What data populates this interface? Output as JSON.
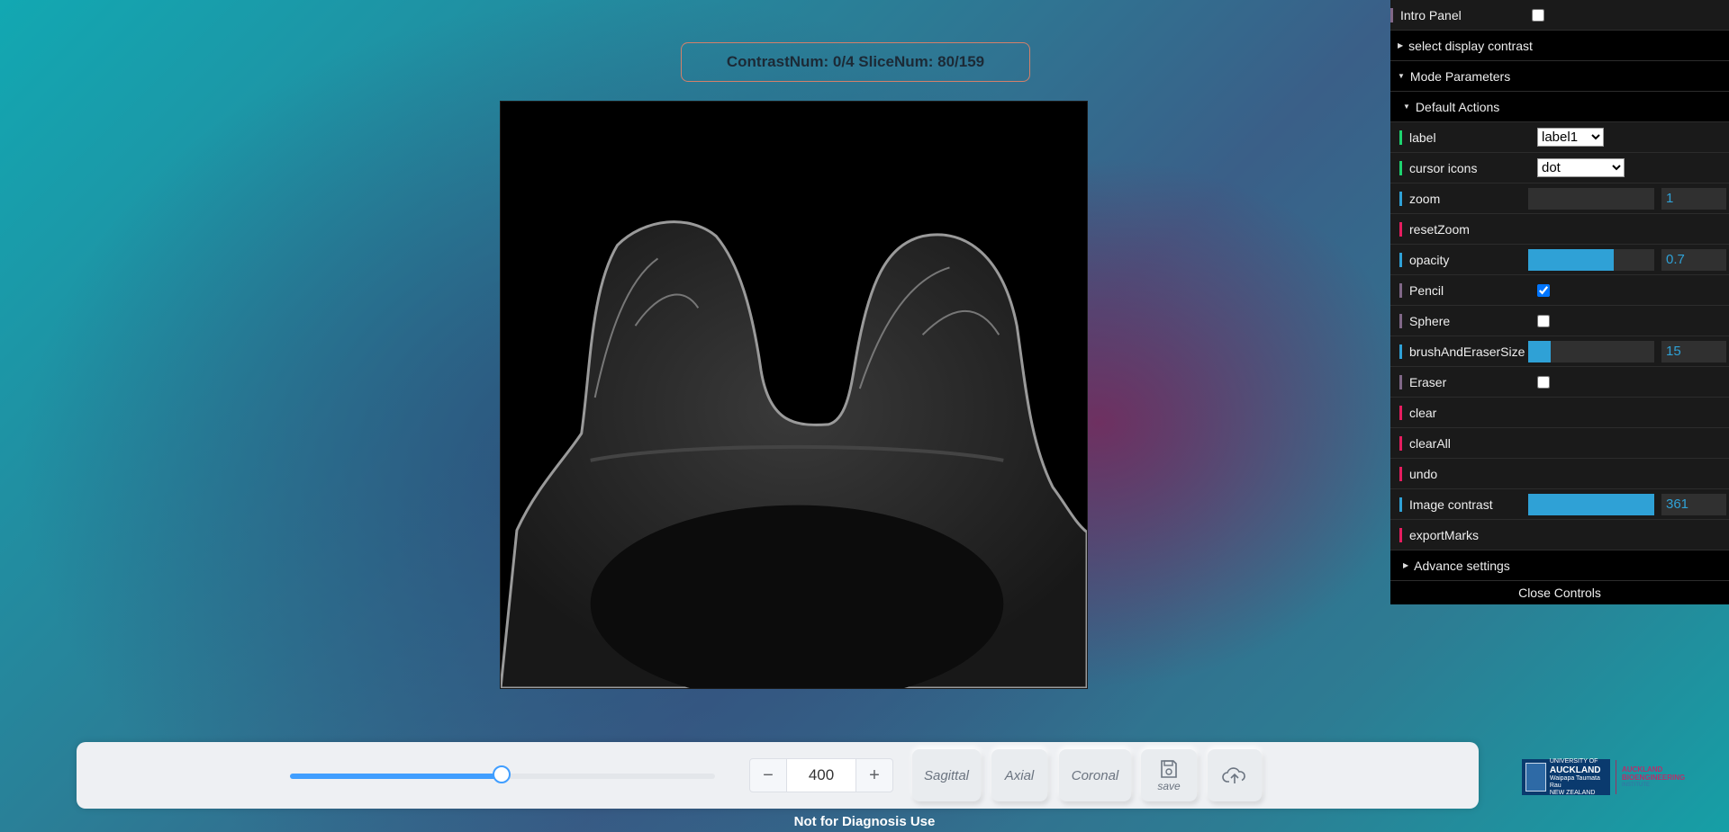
{
  "status": {
    "text": "ContrastNum: 0/4 SliceNum: 80/159"
  },
  "gui": {
    "intro_panel": {
      "label": "Intro Panel",
      "checked": false
    },
    "select_contrast": "select display contrast",
    "mode_parameters": "Mode Parameters",
    "default_actions": "Default Actions",
    "label": {
      "label": "label",
      "value": "label1"
    },
    "cursor_icons": {
      "label": "cursor icons",
      "value": "dot"
    },
    "zoom": {
      "label": "zoom",
      "value": "1",
      "fraction": 0.0
    },
    "reset_zoom": "resetZoom",
    "opacity": {
      "label": "opacity",
      "value": "0.7",
      "fraction": 0.68
    },
    "pencil": {
      "label": "Pencil",
      "checked": true
    },
    "sphere": {
      "label": "Sphere",
      "checked": false
    },
    "brush_size": {
      "label": "brushAndEraserSize",
      "value": "15",
      "fraction": 0.18
    },
    "eraser": {
      "label": "Eraser",
      "checked": false
    },
    "clear": "clear",
    "clear_all": "clearAll",
    "undo": "undo",
    "image_contrast": {
      "label": "Image contrast",
      "value": "361",
      "fraction": 1.0
    },
    "export_marks": "exportMarks",
    "advance_settings": "Advance settings",
    "close_controls": "Close Controls"
  },
  "toolbar": {
    "slider_fraction": 0.5,
    "stepper_value": "400",
    "minus": "−",
    "plus": "+",
    "sagittal": "Sagittal",
    "axial": "Axial",
    "coronal": "Coronal",
    "save": "save"
  },
  "notice": "Not for Diagnosis Use",
  "logo": {
    "uoa_line1": "UNIVERSITY OF",
    "uoa_line2": "AUCKLAND",
    "uoa_line3": "Waipapa Taumata Rau",
    "uoa_line4": "NEW ZEALAND",
    "abi_line1": "AUCKLAND",
    "abi_line2": "BIOENGINEERING",
    "abi_line3": "INSTITUTE"
  },
  "icons": {
    "save": "save-disk-icon",
    "upload": "cloud-upload-icon"
  },
  "colors": {
    "accent": "#2fa1d6",
    "slider_blue": "#409eff",
    "panel_bg": "#1a1a1a"
  }
}
